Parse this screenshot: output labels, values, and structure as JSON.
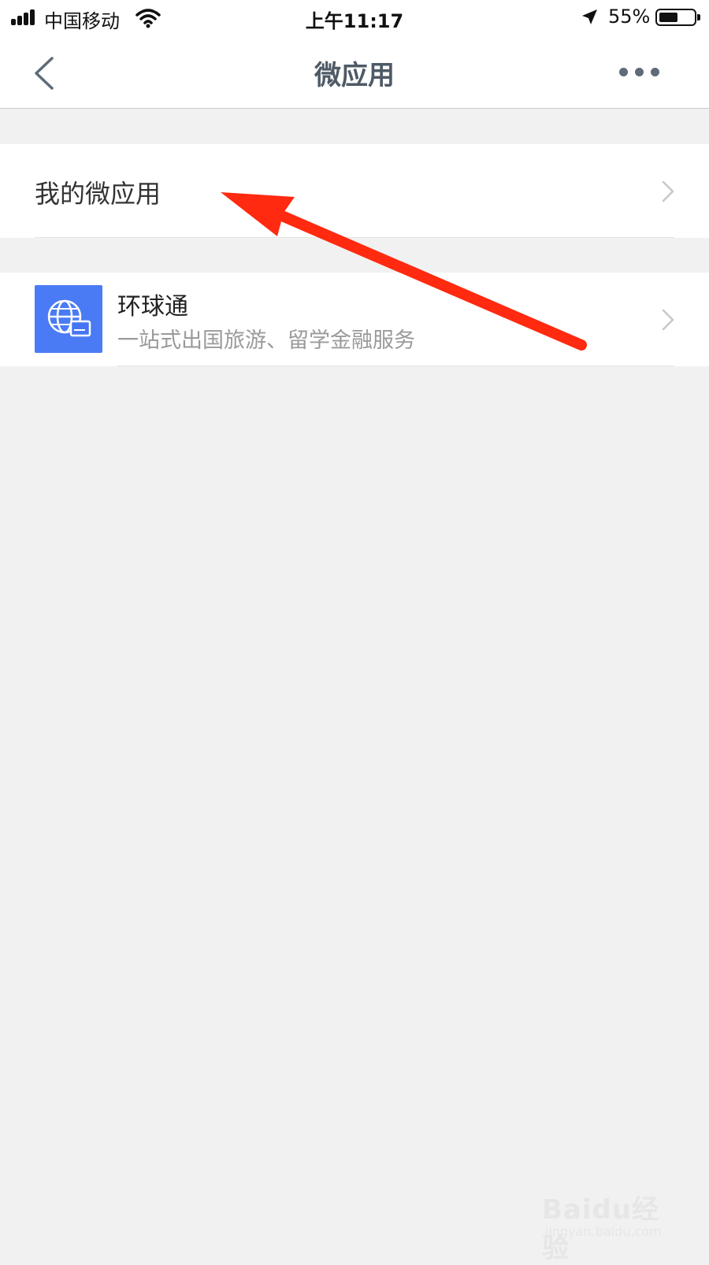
{
  "status_bar": {
    "carrier": "中国移动",
    "time": "上午11:17",
    "battery_percent": "55%",
    "battery_level": 0.55,
    "signal_icon": "signal-bars-icon",
    "wifi_icon": "wifi-icon",
    "location_icon": "location-arrow-icon",
    "battery_icon": "battery-icon"
  },
  "nav": {
    "title": "微应用",
    "back_icon": "chevron-left-icon",
    "more_icon": "more-dots-icon"
  },
  "my_apps": {
    "label": "我的微应用",
    "chevron_icon": "chevron-right-icon"
  },
  "apps": [
    {
      "name": "环球通",
      "description": "一站式出国旅游、留学金融服务",
      "icon": "globe-card-icon",
      "icon_color": "#4a7bf5"
    }
  ],
  "annotation": {
    "arrow_color": "#ff2a10"
  },
  "watermark": {
    "brand": "Baidu经验",
    "url": "jingyan.baidu.com"
  }
}
